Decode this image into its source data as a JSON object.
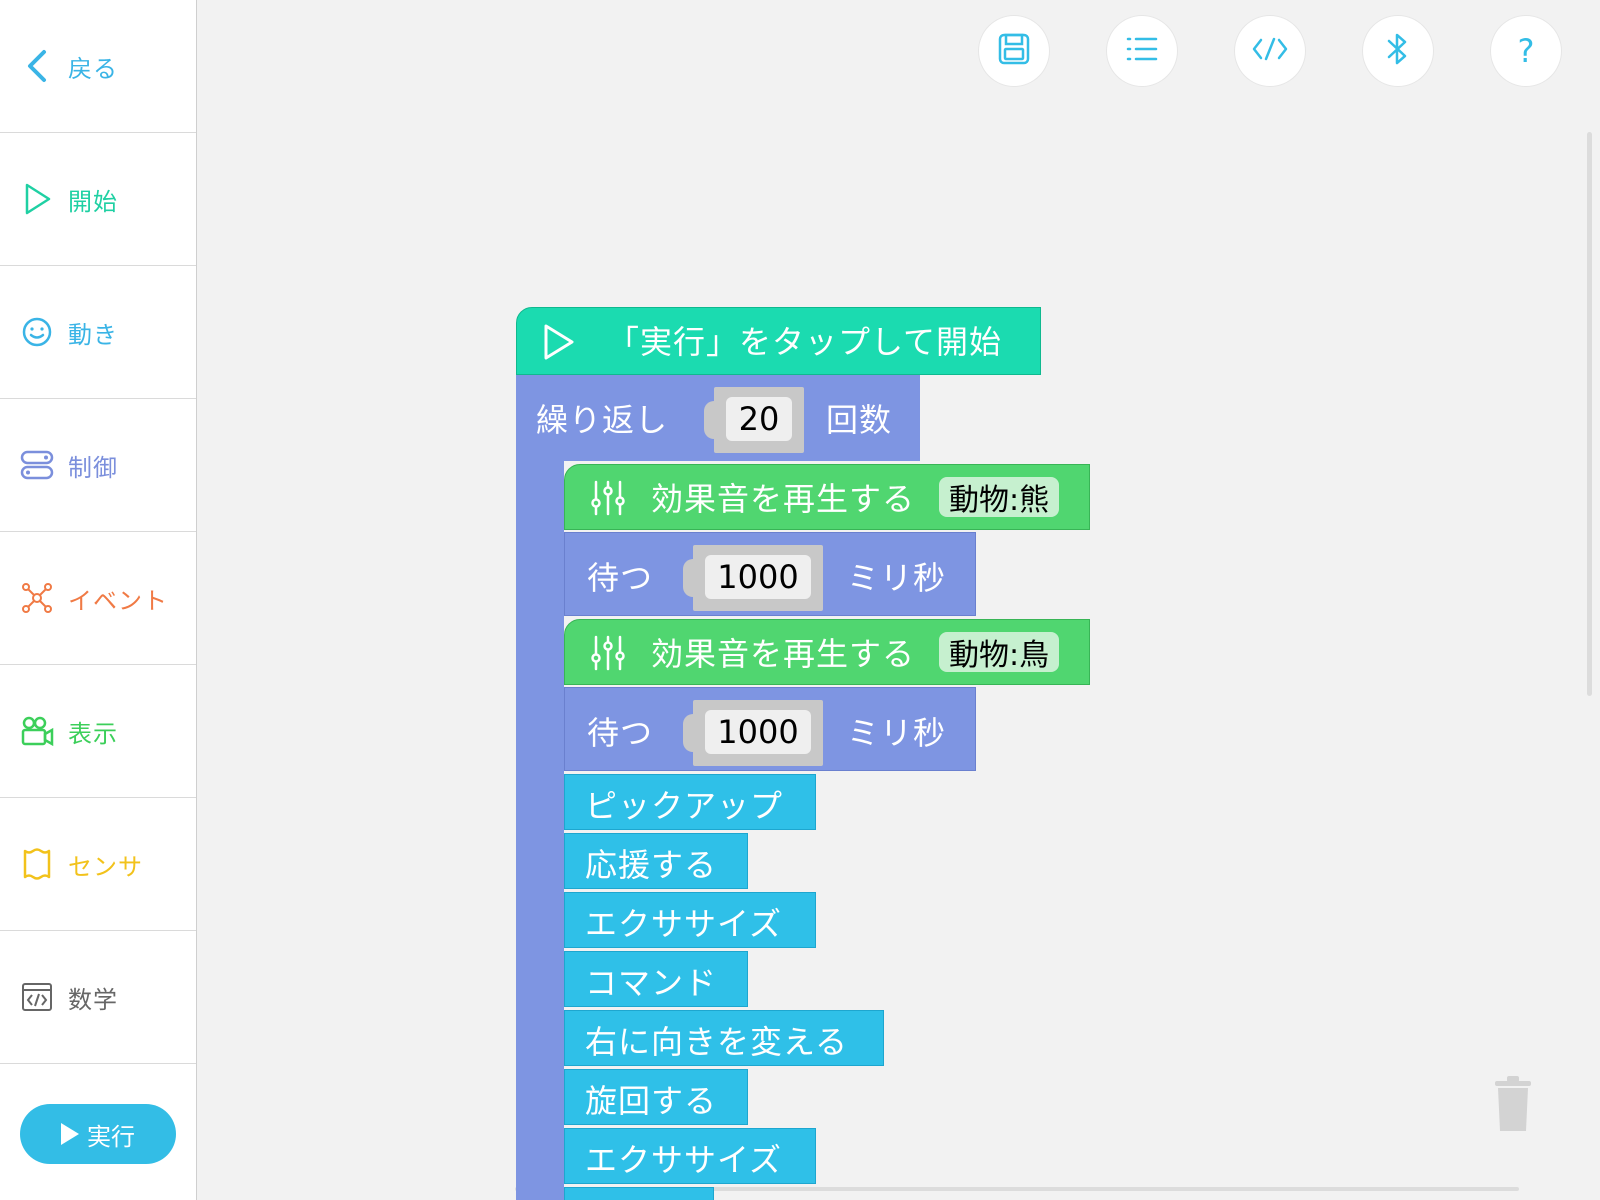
{
  "sidebar": {
    "back_label": "戻る",
    "categories": [
      {
        "label": "開始",
        "color": "#1fd0a3",
        "icon": "play-outline-icon"
      },
      {
        "label": "動き",
        "color": "#3ab4e6",
        "icon": "smile-icon"
      },
      {
        "label": "制御",
        "color": "#7b8fdc",
        "icon": "toggle-icon"
      },
      {
        "label": "イベント",
        "color": "#f07a45",
        "icon": "network-icon"
      },
      {
        "label": "表示",
        "color": "#3ccf5a",
        "icon": "camera-icon"
      },
      {
        "label": "センサ",
        "color": "#f2c21b",
        "icon": "sensor-icon"
      },
      {
        "label": "数学",
        "color": "#666666",
        "icon": "code-window-icon"
      }
    ],
    "run_label": "実行"
  },
  "toolbar": {
    "buttons": [
      "save-icon",
      "list-icon",
      "code-icon",
      "bluetooth-icon",
      "help-icon"
    ],
    "help_glyph": "?"
  },
  "program": {
    "hat_label": "「実行」をタップして開始",
    "repeat": {
      "prefix": "繰り返し",
      "count": "20",
      "suffix": "回数"
    },
    "sound1": {
      "label": "効果音を再生する",
      "value": "動物:熊"
    },
    "wait1": {
      "prefix": "待つ",
      "value": "1000",
      "suffix": "ミリ秒"
    },
    "sound2": {
      "label": "効果音を再生する",
      "value": "動物:鳥"
    },
    "wait2": {
      "prefix": "待つ",
      "value": "1000",
      "suffix": "ミリ秒"
    },
    "actions": [
      "ピックアップ",
      "応援する",
      "エクササイズ",
      "コマンド",
      "右に向きを変える",
      "旋回する",
      "エクササイズ"
    ]
  }
}
